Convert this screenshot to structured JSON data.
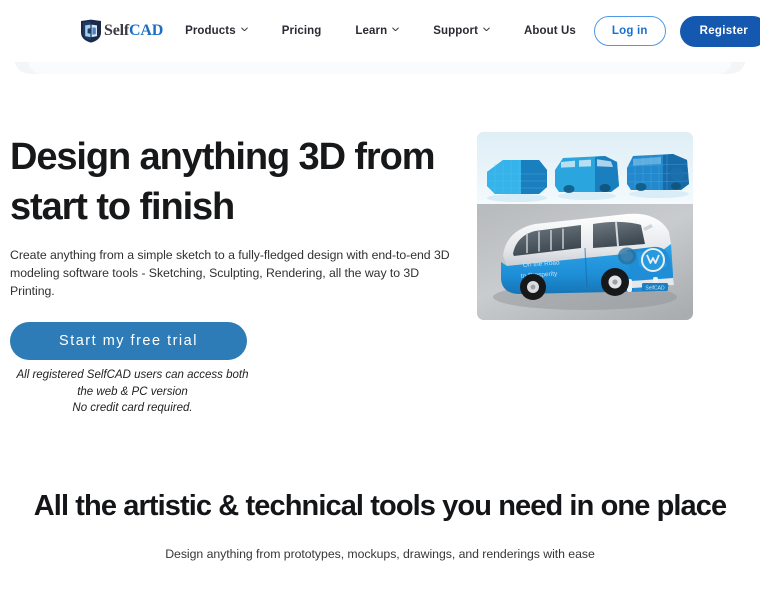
{
  "header": {
    "logo": {
      "icon": "selfcad-shield-logo-icon",
      "text_primary": "Self",
      "text_accent": "CAD"
    },
    "nav": [
      {
        "label": "Products",
        "has_dropdown": true,
        "icon": "chevron-down-icon"
      },
      {
        "label": "Pricing",
        "has_dropdown": false,
        "icon": ""
      },
      {
        "label": "Learn",
        "has_dropdown": true,
        "icon": "chevron-down-icon"
      },
      {
        "label": "Support",
        "has_dropdown": true,
        "icon": "chevron-down-icon"
      },
      {
        "label": "About Us",
        "has_dropdown": false,
        "icon": ""
      }
    ],
    "login_label": "Log in",
    "register_label": "Register"
  },
  "hero": {
    "title": "Design anything 3D from start to finish",
    "subtitle": "Create anything from a simple sketch to a fully-fledged design with end-to-end 3D modeling software tools - Sketching, Sculpting, Rendering, all the way to 3D Printing.",
    "cta_label": "Start my free trial",
    "note_line1": "All registered SelfCAD users can access both",
    "note_line2": "the web & PC version",
    "note_line3": "No credit card required.",
    "media": {
      "icon": "vw-bus-3d-render-image",
      "top_panel_caption": "three blue 3D modeling stages of a VW bus",
      "bottom_panel_caption": "rendered blue and white VW bus",
      "bus_decal_line1": "On the Road",
      "bus_decal_line2": "to Prosperity",
      "bus_plate": "SelfCAD"
    }
  },
  "section2": {
    "title": "All the artistic & technical tools you need in one place",
    "subtitle": "Design anything from prototypes, mockups, drawings, and renderings with ease"
  },
  "colors": {
    "brand_blue": "#1558b0",
    "link_blue": "#1670d4",
    "cta_blue": "#2d7cb8",
    "logo_accent": "#1a6fc4",
    "text_dark": "#17181a",
    "page_bg": "#ffffff"
  }
}
